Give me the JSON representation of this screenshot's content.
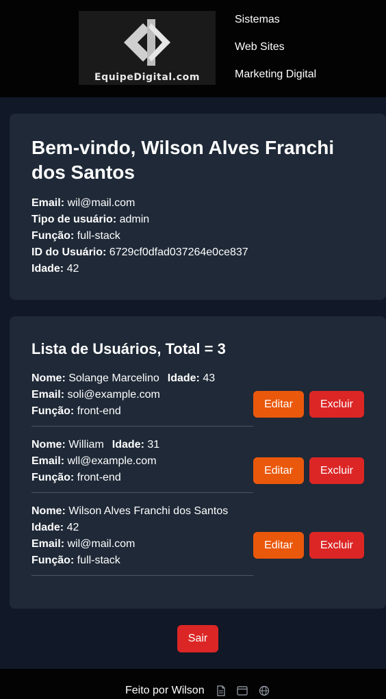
{
  "header": {
    "logo_text": "EquipeDigital.com",
    "nav": [
      "Sistemas",
      "Web Sites",
      "Marketing Digital"
    ]
  },
  "welcome": {
    "title": "Bem-vindo, Wilson Alves Franchi dos Santos",
    "fields": [
      {
        "label": "Email:",
        "value": "wil@mail.com"
      },
      {
        "label": "Tipo de usuário:",
        "value": "admin"
      },
      {
        "label": "Função:",
        "value": "full-stack"
      },
      {
        "label": "ID do Usuário:",
        "value": "6729cf0dfad037264e0ce837"
      },
      {
        "label": "Idade:",
        "value": "42"
      }
    ]
  },
  "users": {
    "title": "Lista de Usuários, Total = 3",
    "labels": {
      "name": "Nome:",
      "age": "Idade:",
      "email": "Email:",
      "role": "Função:"
    },
    "edit_label": "Editar",
    "delete_label": "Excluir",
    "items": [
      {
        "name": "Solange Marcelino",
        "age": "43",
        "email": "soli@example.com",
        "role": "front-end"
      },
      {
        "name": "William",
        "age": "31",
        "email": "wll@example.com",
        "role": "front-end"
      },
      {
        "name": "Wilson Alves Franchi dos Santos",
        "age": "42",
        "email": "wil@mail.com",
        "role": "full-stack"
      }
    ]
  },
  "logout_label": "Sair",
  "footer": {
    "text": "Feito por Wilson",
    "icons": [
      "document-icon",
      "browser-window-icon",
      "globe-icon"
    ]
  },
  "colors": {
    "background": "#111827",
    "card": "#1f2937",
    "header": "#030303",
    "edit": "#ea580c",
    "delete": "#dc2626"
  }
}
